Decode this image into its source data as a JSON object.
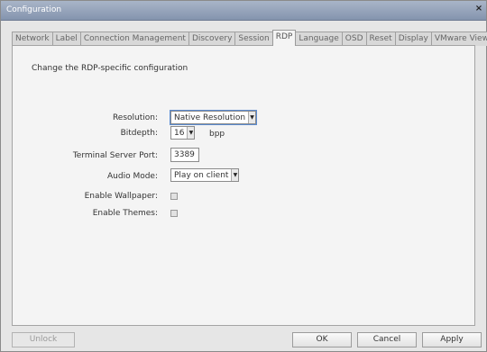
{
  "window": {
    "title": "Configuration"
  },
  "tabs": [
    {
      "label": "Network"
    },
    {
      "label": "Label"
    },
    {
      "label": "Connection Management"
    },
    {
      "label": "Discovery"
    },
    {
      "label": "Session"
    },
    {
      "label": "RDP"
    },
    {
      "label": "Language"
    },
    {
      "label": "OSD"
    },
    {
      "label": "Reset"
    },
    {
      "label": "Display"
    },
    {
      "label": "VMware View"
    }
  ],
  "active_tab": "RDP",
  "panel": {
    "description": "Change the RDP-specific configuration",
    "resolution": {
      "label": "Resolution:",
      "value": "Native Resolution"
    },
    "bitdepth": {
      "label": "Bitdepth:",
      "value": "16",
      "unit": "bpp"
    },
    "port": {
      "label": "Terminal Server Port:",
      "value": "3389"
    },
    "audio": {
      "label": "Audio Mode:",
      "value": "Play on client"
    },
    "wallpaper": {
      "label": "Enable Wallpaper:",
      "checked": false
    },
    "themes": {
      "label": "Enable Themes:",
      "checked": false
    }
  },
  "buttons": {
    "unlock": "Unlock",
    "ok": "OK",
    "cancel": "Cancel",
    "apply": "Apply"
  }
}
